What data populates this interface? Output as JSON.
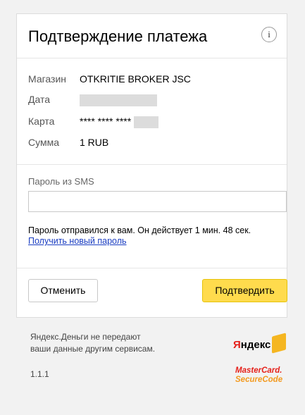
{
  "header": {
    "title": "Подтверждение платежа",
    "info_icon": "i"
  },
  "details": [
    {
      "label": "Магазин",
      "value": "OTKRITIE BROKER JSC"
    },
    {
      "label": "Дата",
      "value": ""
    },
    {
      "label": "Карта",
      "value": "**** **** ****"
    },
    {
      "label": "Сумма",
      "value": "1 RUB"
    }
  ],
  "sms": {
    "label": "Пароль из SMS",
    "note": "Пароль отправился к вам. Он действует 1 мин. 48 сек.",
    "link": "Получить новый пароль"
  },
  "buttons": {
    "cancel": "Отменить",
    "confirm": "Подтвердить"
  },
  "footer": {
    "line1": "Яндекс.Деньги не передают",
    "line2": "ваши данные другим сервисам.",
    "version": "1.1.1",
    "yandex_logo_first": "Я",
    "yandex_logo_rest": "ндекс",
    "mc_line1": "MasterCard.",
    "mc_line2": "SecureCode"
  },
  "colors": {
    "confirm_bg": "#ffdb4d",
    "link": "#1a3dc1"
  }
}
